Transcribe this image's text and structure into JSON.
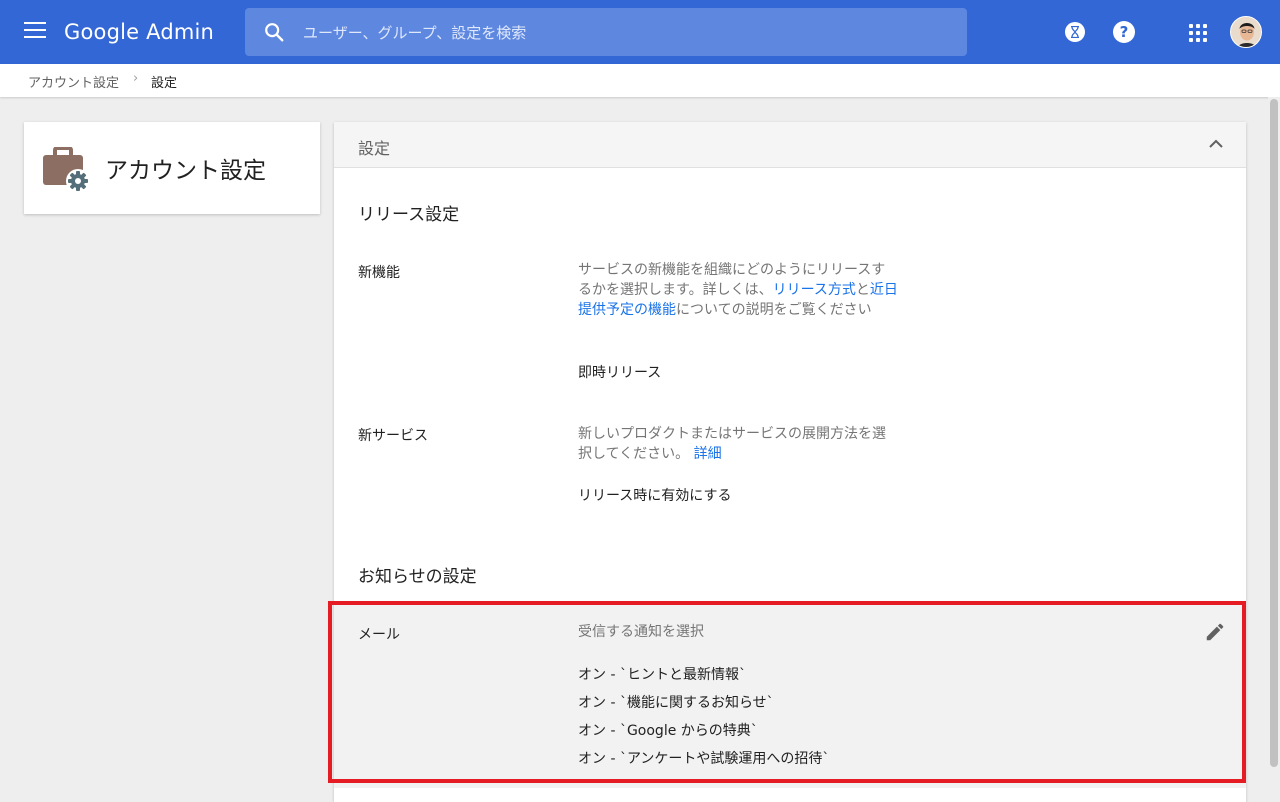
{
  "app": {
    "brand": "Google Admin"
  },
  "search": {
    "placeholder": "ユーザー、グループ、設定を検索"
  },
  "header_icons": [
    "menu-icon",
    "search-icon",
    "hourglass-icon",
    "help-icon",
    "apps-grid-icon",
    "avatar"
  ],
  "breadcrumb": {
    "parent": "アカウント設定",
    "separator": "›",
    "current": "設定"
  },
  "left_card": {
    "title": "アカウント設定",
    "icon": "briefcase-gear-icon"
  },
  "main_card": {
    "header": "設定",
    "release_section": {
      "title": "リリース設定",
      "new_features": {
        "label": "新機能",
        "desc_1": "サービスの新機能を組織にどのようにリリースするかを選択します。詳しくは、",
        "link_1": "リリース方式",
        "desc_2": "と",
        "link_2": "近日提供予定の機能",
        "desc_3": "についての説明をご覧ください",
        "value": "即時リリース"
      },
      "new_services": {
        "label": "新サービス",
        "desc": "新しいプロダクトまたはサービスの展開方法を選択してください。",
        "link": "詳細",
        "value": "リリース時に有効にする"
      }
    },
    "notification_section": {
      "title": "お知らせの設定",
      "mail": {
        "label": "メール",
        "desc": "受信する通知を選択",
        "items": [
          "オン - `ヒントと最新情報`",
          "オン - `機能に関するお知らせ`",
          "オン - `Google からの特典`",
          "オン - `アンケートや試験運用への招待`"
        ]
      }
    }
  },
  "colors": {
    "topbar": "#3367d6",
    "link": "#1a73e8",
    "highlight_border": "#e51c23"
  }
}
